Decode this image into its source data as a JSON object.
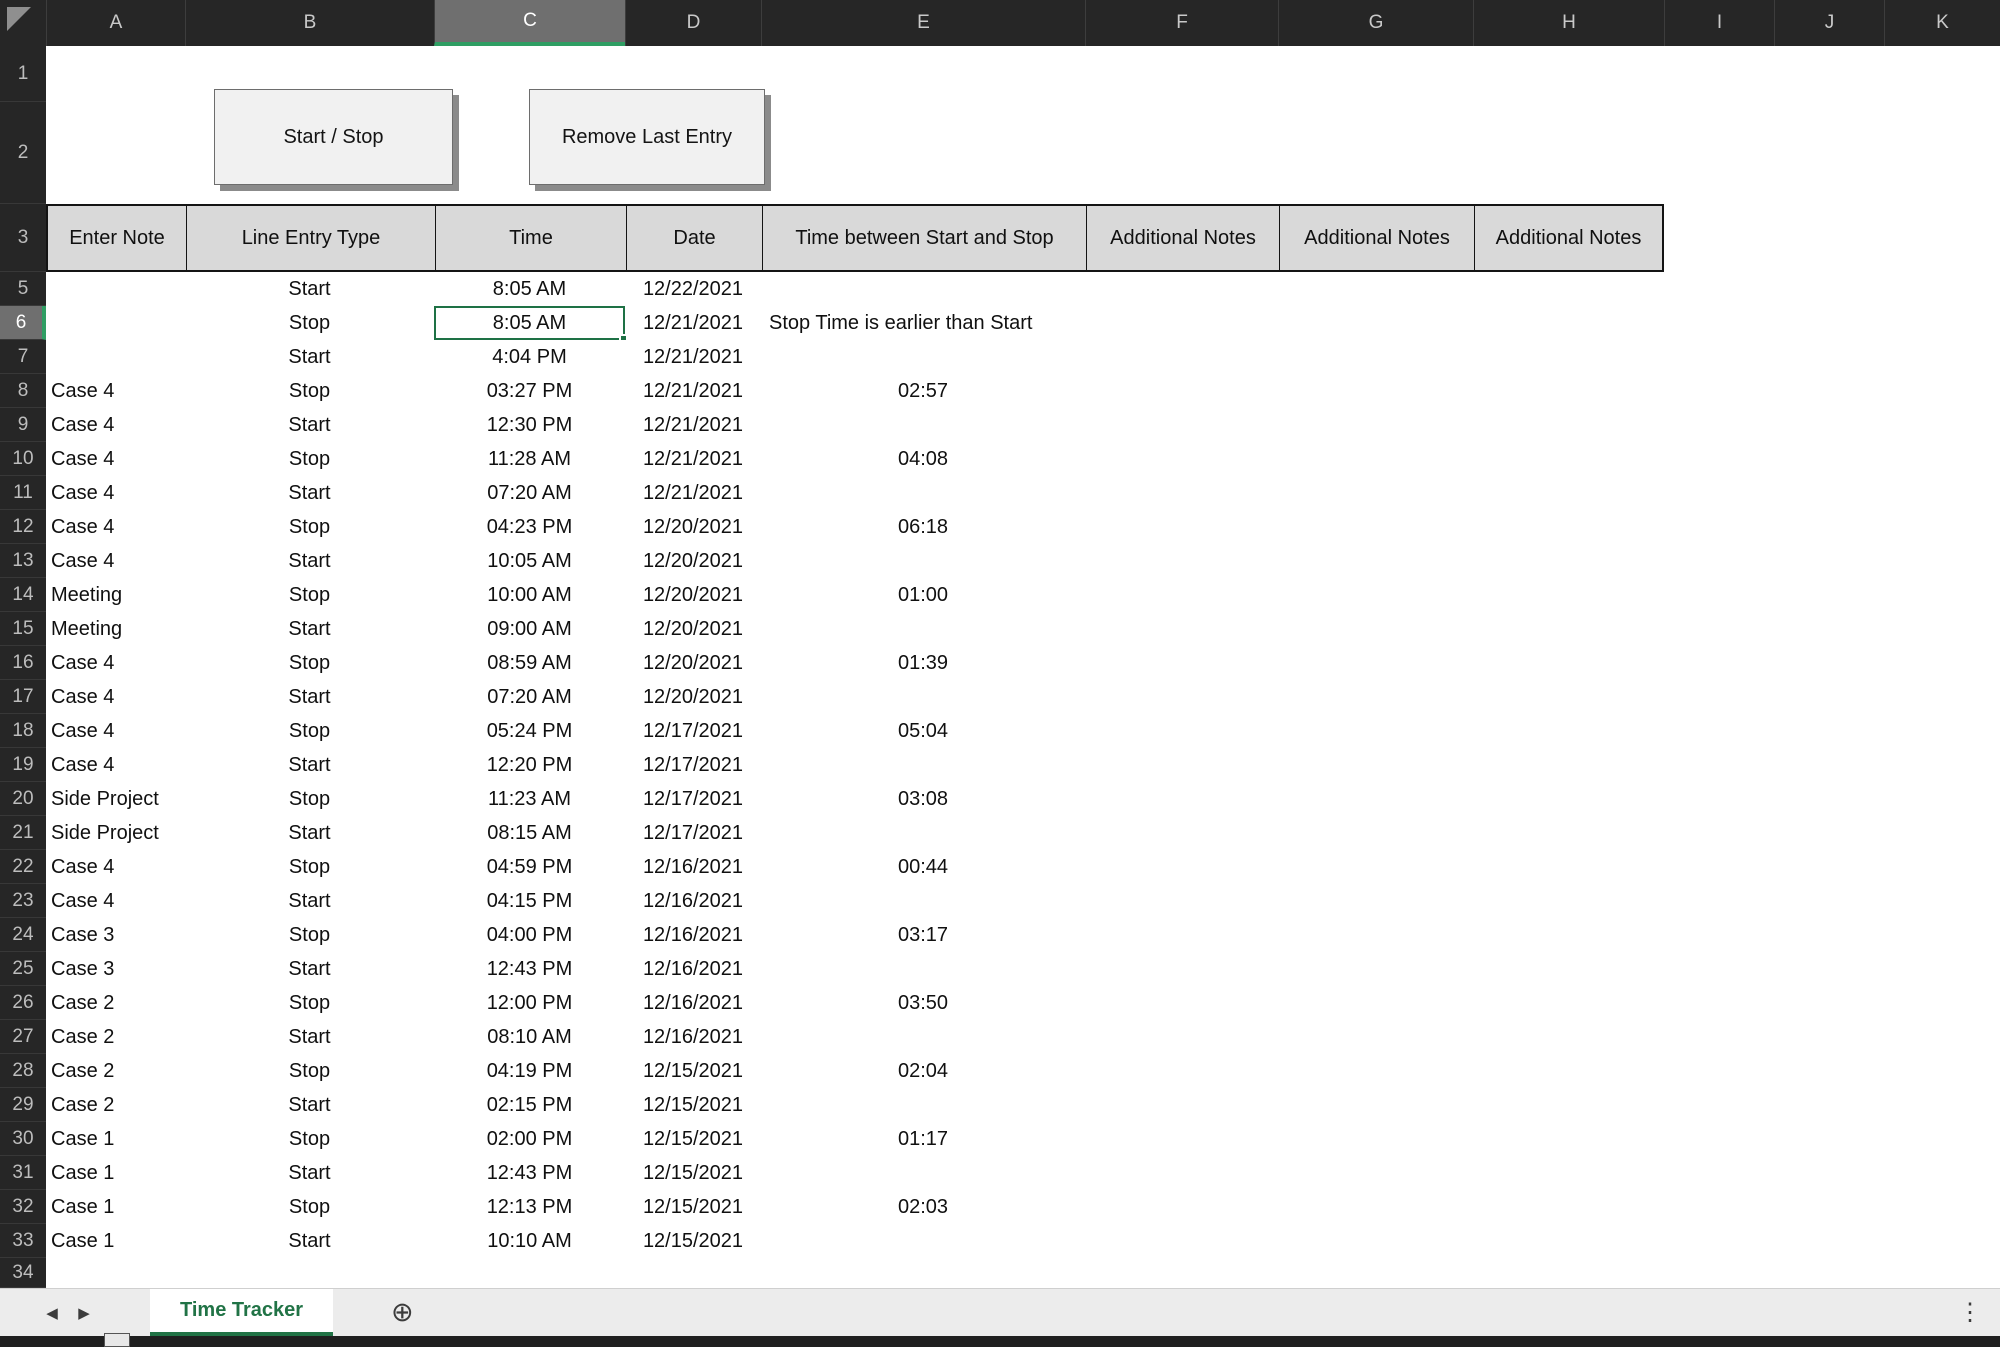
{
  "grid": {
    "column_letters": [
      "A",
      "B",
      "C",
      "D",
      "E",
      "F",
      "G",
      "H",
      "I",
      "J",
      "K"
    ],
    "selected_column": "C",
    "selected_row": "6",
    "selected_cell": "C6",
    "top_row_numbers": [
      "1",
      "2",
      "3"
    ],
    "partial_bottom_row": "34"
  },
  "buttons": {
    "start_stop": "Start / Stop",
    "remove_last_entry": "Remove Last Entry"
  },
  "table": {
    "headers": [
      "Enter Note",
      "Line Entry Type",
      "Time",
      "Date",
      "Time between Start and Stop",
      "Additional Notes",
      "Additional Notes",
      "Additional Notes"
    ],
    "records": [
      {
        "row": "5",
        "note": "",
        "entry_type": "Start",
        "time": "8:05 AM",
        "date": "12/22/2021",
        "duration": "",
        "warning": ""
      },
      {
        "row": "6",
        "note": "",
        "entry_type": "Stop",
        "time": "8:05 AM",
        "date": "12/21/2021",
        "duration": "",
        "warning": "Stop Time is earlier than Start"
      },
      {
        "row": "7",
        "note": "",
        "entry_type": "Start",
        "time": "4:04 PM",
        "date": "12/21/2021",
        "duration": "",
        "warning": ""
      },
      {
        "row": "8",
        "note": "Case 4",
        "entry_type": "Stop",
        "time": "03:27 PM",
        "date": "12/21/2021",
        "duration": "02:57",
        "warning": ""
      },
      {
        "row": "9",
        "note": "Case 4",
        "entry_type": "Start",
        "time": "12:30 PM",
        "date": "12/21/2021",
        "duration": "",
        "warning": ""
      },
      {
        "row": "10",
        "note": "Case 4",
        "entry_type": "Stop",
        "time": "11:28 AM",
        "date": "12/21/2021",
        "duration": "04:08",
        "warning": ""
      },
      {
        "row": "11",
        "note": "Case 4",
        "entry_type": "Start",
        "time": "07:20 AM",
        "date": "12/21/2021",
        "duration": "",
        "warning": ""
      },
      {
        "row": "12",
        "note": "Case 4",
        "entry_type": "Stop",
        "time": "04:23 PM",
        "date": "12/20/2021",
        "duration": "06:18",
        "warning": ""
      },
      {
        "row": "13",
        "note": "Case 4",
        "entry_type": "Start",
        "time": "10:05 AM",
        "date": "12/20/2021",
        "duration": "",
        "warning": ""
      },
      {
        "row": "14",
        "note": "Meeting",
        "entry_type": "Stop",
        "time": "10:00 AM",
        "date": "12/20/2021",
        "duration": "01:00",
        "warning": ""
      },
      {
        "row": "15",
        "note": "Meeting",
        "entry_type": "Start",
        "time": "09:00 AM",
        "date": "12/20/2021",
        "duration": "",
        "warning": ""
      },
      {
        "row": "16",
        "note": "Case 4",
        "entry_type": "Stop",
        "time": "08:59 AM",
        "date": "12/20/2021",
        "duration": "01:39",
        "warning": ""
      },
      {
        "row": "17",
        "note": "Case 4",
        "entry_type": "Start",
        "time": "07:20 AM",
        "date": "12/20/2021",
        "duration": "",
        "warning": ""
      },
      {
        "row": "18",
        "note": "Case 4",
        "entry_type": "Stop",
        "time": "05:24 PM",
        "date": "12/17/2021",
        "duration": "05:04",
        "warning": ""
      },
      {
        "row": "19",
        "note": "Case 4",
        "entry_type": "Start",
        "time": "12:20 PM",
        "date": "12/17/2021",
        "duration": "",
        "warning": ""
      },
      {
        "row": "20",
        "note": "Side Project",
        "entry_type": "Stop",
        "time": "11:23 AM",
        "date": "12/17/2021",
        "duration": "03:08",
        "warning": ""
      },
      {
        "row": "21",
        "note": "Side Project",
        "entry_type": "Start",
        "time": "08:15 AM",
        "date": "12/17/2021",
        "duration": "",
        "warning": ""
      },
      {
        "row": "22",
        "note": "Case 4",
        "entry_type": "Stop",
        "time": "04:59 PM",
        "date": "12/16/2021",
        "duration": "00:44",
        "warning": ""
      },
      {
        "row": "23",
        "note": "Case 4",
        "entry_type": "Start",
        "time": "04:15 PM",
        "date": "12/16/2021",
        "duration": "",
        "warning": ""
      },
      {
        "row": "24",
        "note": "Case 3",
        "entry_type": "Stop",
        "time": "04:00 PM",
        "date": "12/16/2021",
        "duration": "03:17",
        "warning": ""
      },
      {
        "row": "25",
        "note": "Case 3",
        "entry_type": "Start",
        "time": "12:43 PM",
        "date": "12/16/2021",
        "duration": "",
        "warning": ""
      },
      {
        "row": "26",
        "note": "Case 2",
        "entry_type": "Stop",
        "time": "12:00 PM",
        "date": "12/16/2021",
        "duration": "03:50",
        "warning": ""
      },
      {
        "row": "27",
        "note": "Case 2",
        "entry_type": "Start",
        "time": "08:10 AM",
        "date": "12/16/2021",
        "duration": "",
        "warning": ""
      },
      {
        "row": "28",
        "note": "Case 2",
        "entry_type": "Stop",
        "time": "04:19 PM",
        "date": "12/15/2021",
        "duration": "02:04",
        "warning": ""
      },
      {
        "row": "29",
        "note": "Case 2",
        "entry_type": "Start",
        "time": "02:15 PM",
        "date": "12/15/2021",
        "duration": "",
        "warning": ""
      },
      {
        "row": "30",
        "note": "Case 1",
        "entry_type": "Stop",
        "time": "02:00 PM",
        "date": "12/15/2021",
        "duration": "01:17",
        "warning": ""
      },
      {
        "row": "31",
        "note": "Case 1",
        "entry_type": "Start",
        "time": "12:43 PM",
        "date": "12/15/2021",
        "duration": "",
        "warning": ""
      },
      {
        "row": "32",
        "note": "Case 1",
        "entry_type": "Stop",
        "time": "12:13 PM",
        "date": "12/15/2021",
        "duration": "02:03",
        "warning": ""
      },
      {
        "row": "33",
        "note": "Case 1",
        "entry_type": "Start",
        "time": "10:10 AM",
        "date": "12/15/2021",
        "duration": "",
        "warning": ""
      }
    ]
  },
  "sheet_bar": {
    "active_tab": "Time Tracker",
    "icons": {
      "prev_sheet": "◀",
      "next_sheet": "▶",
      "add_sheet": "⊕",
      "more": "⋮"
    }
  },
  "colors": {
    "accent_green": "#217346",
    "selection_green": "#1e7145",
    "header_underline_green": "#2f9e63",
    "dark_header_bg": "#262626",
    "selected_header_bg": "#6f6f6f",
    "table_header_bg": "#d9d9d9",
    "button_bg": "#f1f1f1",
    "tab_bar_bg": "#ececec"
  }
}
